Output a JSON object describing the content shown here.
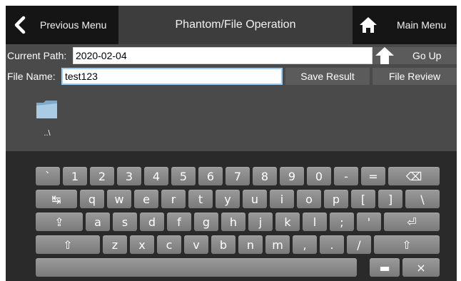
{
  "header": {
    "prev_label": "Previous Menu",
    "title": "Phantom/File Operation",
    "main_label": "Main Menu"
  },
  "path": {
    "label": "Current Path:",
    "value": "2020-02-04",
    "go_up_label": "Go Up"
  },
  "file": {
    "label": "File Name:",
    "value": "test123",
    "save_label": "Save Result",
    "review_label": "File Review"
  },
  "folder_item": {
    "label": "..\\"
  },
  "colors": {
    "background": "#4a4a4a",
    "header_button": "#151515",
    "keyboard": "#2a2a2a",
    "key": "#8a8a8a"
  },
  "keyboard": {
    "row1": [
      "`",
      "1",
      "2",
      "3",
      "4",
      "5",
      "6",
      "7",
      "8",
      "9",
      "0",
      "-",
      "=",
      "⌫"
    ],
    "row2": [
      "↹",
      "q",
      "w",
      "e",
      "r",
      "t",
      "y",
      "u",
      "i",
      "o",
      "p",
      "[",
      "]",
      "\\"
    ],
    "row3": [
      "⇪",
      "a",
      "s",
      "d",
      "f",
      "g",
      "h",
      "j",
      "k",
      "l",
      ";",
      "'",
      "⏎"
    ],
    "row4": [
      "⇧",
      "z",
      "x",
      "c",
      "v",
      "b",
      "n",
      "m",
      ",",
      ".",
      "/",
      "⇧"
    ],
    "row5": [
      " ",
      "▬",
      "×"
    ]
  }
}
